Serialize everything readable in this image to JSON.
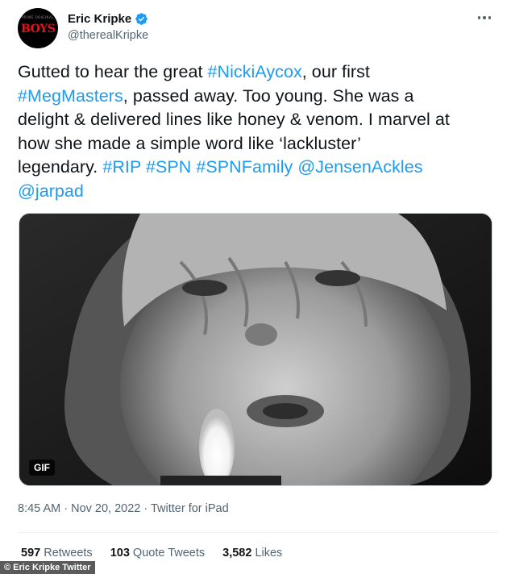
{
  "author": {
    "name": "Eric Kripke",
    "handle": "@therealKripke",
    "avatar_small_text": "PRIME ORIGINAL",
    "avatar_logo_text": "BOYS"
  },
  "tweet": {
    "segments": [
      [
        {
          "t": "Gutted to hear the great ",
          "link": false
        },
        {
          "t": "#NickiAycox",
          "link": true
        },
        {
          "t": ", our first",
          "link": false
        }
      ],
      [
        {
          "t": "#MegMasters",
          "link": true
        },
        {
          "t": ", passed away. Too young. She was a",
          "link": false
        }
      ],
      [
        {
          "t": "delight & delivered lines like honey & venom. I marvel at",
          "link": false
        }
      ],
      [
        {
          "t": "how she made a simple word like ‘lackluster’",
          "link": false
        }
      ],
      [
        {
          "t": "legendary. ",
          "link": false
        },
        {
          "t": "#RIP",
          "link": true
        },
        {
          "t": " ",
          "link": false
        },
        {
          "t": "#SPN",
          "link": true
        },
        {
          "t": " ",
          "link": false
        },
        {
          "t": "#SPNFamily",
          "link": true
        },
        {
          "t": " ",
          "link": false
        },
        {
          "t": "@JensenAckles",
          "link": true
        }
      ],
      [
        {
          "t": "@jarpad",
          "link": true
        }
      ]
    ]
  },
  "media": {
    "badge": "GIF",
    "tone": "black-and-white"
  },
  "meta": {
    "time": "8:45 AM",
    "separator": " · ",
    "date": "Nov 20, 2022",
    "source": "Twitter for iPad"
  },
  "stats": {
    "retweets_count": "597",
    "retweets_label": "Retweets",
    "quotes_count": "103",
    "quotes_label": "Quote Tweets",
    "likes_count": "3,582",
    "likes_label": "Likes"
  },
  "credit": "© Eric Kripke Twitter",
  "icons": {
    "verified": "verified-badge-icon",
    "more": "more-horizontal-icon"
  },
  "colors": {
    "link": "#1d9bf0",
    "secondary_text": "#536471",
    "verified": "#1d9bf0",
    "avatar_logo": "#e0141e"
  }
}
